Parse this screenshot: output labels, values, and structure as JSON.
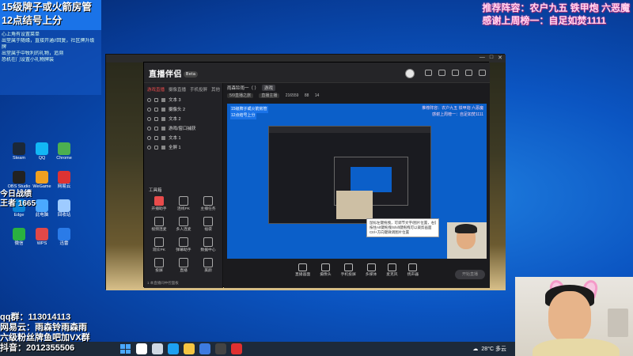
{
  "overlay": {
    "top_left_lines": [
      "15级牌子或火箭房管",
      "12点结号上分"
    ],
    "top_left_chat": [
      "",
      "心上角有设置菜单",
      "",
      "出堂属于随缘，直接开通//回复，社区牌升级",
      "牌",
      "出堂属于中牧利的礼物，追溯",
      "恐机在门设置小礼物牌装"
    ],
    "top_right_lines": [
      "推荐阵容：农户九五 铁甲炮 六恶魔",
      "感谢上周榜一：自足如焚1111"
    ],
    "bottom_left_lines": [
      "qq群：113014113",
      "网易云：雨森铃雨森雨",
      "六级粉丝牌鱼吧加VX群",
      "抖音：2012355506"
    ],
    "stats_lines": [
      "今日战绩",
      "王者 1665"
    ]
  },
  "desktop_icons": [
    {
      "label": "Steam",
      "color": "#1b2838"
    },
    {
      "label": "QQ",
      "color": "#12b7f5"
    },
    {
      "label": "Chrome",
      "color": "#4caf50"
    },
    {
      "label": "OBS Studio",
      "color": "#222"
    },
    {
      "label": "WeGame",
      "color": "#f0a020"
    },
    {
      "label": "网易云",
      "color": "#d33"
    },
    {
      "label": "Edge",
      "color": "#0a84d6"
    },
    {
      "label": "此电脑",
      "color": "#4aa8ff"
    },
    {
      "label": "回收站",
      "color": "#9ecbff"
    },
    {
      "label": "微信",
      "color": "#2ab140"
    },
    {
      "label": "WPS",
      "color": "#e04848"
    },
    {
      "label": "迅雷",
      "color": "#2a7be8"
    }
  ],
  "window": {
    "logo": "直播伴侣",
    "logo_badge": "Beta",
    "controls": [
      "—",
      "□",
      "✕"
    ],
    "tabs": [
      "游戏直播",
      "摄像直播",
      "手机投屏",
      "其他"
    ],
    "sources": [
      {
        "label": "文本 3"
      },
      {
        "label": "摄像头 2"
      },
      {
        "label": "文本 2"
      },
      {
        "label": "游戏/窗口捕获"
      },
      {
        "label": "文本 1"
      },
      {
        "label": "全屏 1"
      }
    ],
    "tools_label": "工具箱",
    "tools": [
      {
        "label": "开播助手",
        "hot": true
      },
      {
        "label": "连线PK",
        "hot": false
      },
      {
        "label": "主播任务",
        "hot": false
      },
      {
        "label": "视频连麦",
        "hot": false
      },
      {
        "label": "多人连麦",
        "hot": false
      },
      {
        "label": "福袋",
        "hot": false
      },
      {
        "label": "观众PK",
        "hot": false
      },
      {
        "label": "弹幕助手",
        "hot": false
      },
      {
        "label": "数据中心",
        "hot": false
      },
      {
        "label": "投屏",
        "hot": false
      },
      {
        "label": "直播",
        "hot": false
      },
      {
        "label": "美颜",
        "hot": false
      }
    ],
    "status_text": "1 本直播间中控面板",
    "room_title": "雨森铃雨一（ ）",
    "room_tag": "游戏",
    "room_sub": {
      "chip1": "5/9直播之旅",
      "chip2": "直播主播",
      "viewers": "216559",
      "likes": "88",
      "followers": "14"
    },
    "preview_texts": {
      "left_a": "15级牌子或火箭房管",
      "left_b": "12点结号上分",
      "right_a": "推荐阵容：农户九五 铁甲炮 六恶魔",
      "right_b": "感谢上周榜一：自足如焚1111"
    },
    "tooltip": [
      "鼠标左键拖拽，可调节文字/图片位置，右键画面编辑",
      "按住Alt键拖拽/Shift键拖拽可以裁剪画面",
      "Ctrl+方向键微调图片位置"
    ],
    "bottom_buttons": [
      "直播画面",
      "摄像头",
      "手机投屏",
      "多媒体",
      "麦克风",
      "扬声器"
    ],
    "start_button": "开始直播"
  },
  "taskbar": {
    "weather": "28°C 多云",
    "icons": [
      "search",
      "task-view",
      "edge",
      "explorer",
      "store",
      "obs",
      "netease"
    ]
  }
}
